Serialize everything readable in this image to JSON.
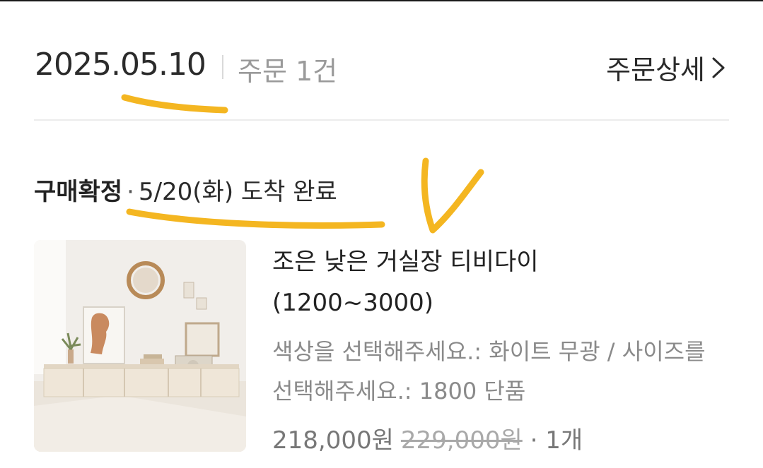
{
  "order": {
    "date": "2025.05.10",
    "count_label": "주문 1건",
    "detail_label": "주문상세"
  },
  "status": {
    "label": "구매확정",
    "separator": "·",
    "delivery": "5/20(화) 도착 완료"
  },
  "product": {
    "name_line1": "조은 낮은 거실장 티비다이",
    "name_line2": "(1200~3000)",
    "option": "색상을 선택해주세요.: 화이트 무광 / 사이즈를 선택해주세요.: 1800 단품",
    "price": "218,000원",
    "original_price": "229,000원",
    "quantity": "· 1개"
  },
  "colors": {
    "annotation": "#f4b621",
    "accent_text": "#222222",
    "muted_text": "#8a8a8a"
  },
  "icons": {
    "detail": "chevron-right-icon"
  }
}
